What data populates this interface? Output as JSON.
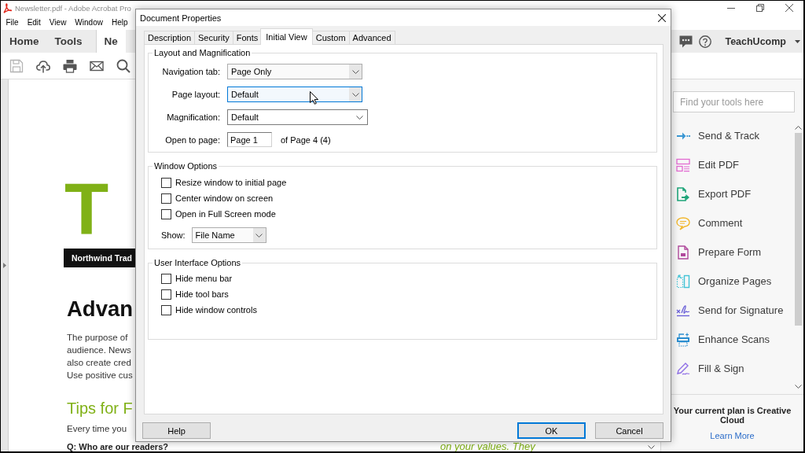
{
  "app_window": {
    "title": "Newsletter.pdf - Adobe Acrobat Pro",
    "menu": [
      "File",
      "Edit",
      "View",
      "Window",
      "Help"
    ],
    "nav_tabs": [
      {
        "label": "Home",
        "selected": false
      },
      {
        "label": "Tools",
        "selected": false
      },
      {
        "label": "Ne",
        "selected": true
      }
    ],
    "account": "TeachUcomp"
  },
  "document": {
    "title": "T",
    "banner": "Northwind Trad",
    "heading": "Advan",
    "paragraph_lines": [
      "The purpose of",
      "audience. News",
      "also create cred",
      "Use positive cus"
    ],
    "subheading": "Tips for F",
    "body": "Every time you",
    "question": "Q: Who are our readers?",
    "quote": "on your values. They"
  },
  "tools_panel": {
    "search": {
      "placeholder": "Find your tools here"
    },
    "tools": [
      {
        "label": "Send & Track",
        "color": "#3b97d3"
      },
      {
        "label": "Edit PDF",
        "color": "#e26ad1"
      },
      {
        "label": "Export PDF",
        "color": "#1fa57a"
      },
      {
        "label": "Comment",
        "color": "#f2b62a"
      },
      {
        "label": "Prepare Form",
        "color": "#b04a9c"
      },
      {
        "label": "Organize Pages",
        "color": "#42c3d6"
      },
      {
        "label": "Send for Signature",
        "color": "#6b61d8"
      },
      {
        "label": "Enhance Scans",
        "color": "#2b8ed0"
      },
      {
        "label": "Fill & Sign",
        "color": "#8f6fe6"
      }
    ],
    "plan_note": "Your current plan is Creative Cloud",
    "link": "Learn More"
  },
  "dialog": {
    "title": "Document Properties",
    "tabs": [
      {
        "label": "Description",
        "selected": false
      },
      {
        "label": "Security",
        "selected": false
      },
      {
        "label": "Fonts",
        "selected": false
      },
      {
        "label": "Initial View",
        "selected": true
      },
      {
        "label": "Custom",
        "selected": false
      },
      {
        "label": "Advanced",
        "selected": false
      }
    ],
    "groups": [
      {
        "title": "Layout and Magnification",
        "kind": "form",
        "rows": [
          {
            "kind": "dropdown",
            "label": "Navigation tab:",
            "value": "Page Only",
            "hovered": false
          },
          {
            "kind": "dropdown",
            "label": "Page layout:",
            "value": "Default",
            "hovered": true
          },
          {
            "kind": "combo",
            "label": "Magnification:",
            "value": "Default"
          },
          {
            "kind": "page",
            "label": "Open to page:",
            "value": "Page 1",
            "suffix": "of Page 4 (4)"
          }
        ]
      },
      {
        "title": "Window Options",
        "kind": "checklist",
        "rows": [
          {
            "kind": "checkbox",
            "label": "Resize window to initial page",
            "checked": false
          },
          {
            "kind": "checkbox",
            "label": "Center window on screen",
            "checked": false
          },
          {
            "kind": "checkbox",
            "label": "Open in Full Screen mode",
            "checked": false
          },
          {
            "kind": "dropdown",
            "label": "Show:",
            "value": "File Name",
            "hovered": false
          }
        ]
      },
      {
        "title": "User Interface Options",
        "kind": "checklist",
        "rows": [
          {
            "kind": "checkbox",
            "label": "Hide menu bar",
            "checked": false
          },
          {
            "kind": "checkbox",
            "label": "Hide tool bars",
            "checked": false
          },
          {
            "kind": "checkbox",
            "label": "Hide window controls",
            "checked": false
          }
        ]
      }
    ],
    "buttons": [
      {
        "label": "Help",
        "default": false
      },
      {
        "label": "OK",
        "default": true
      },
      {
        "label": "Cancel",
        "default": false
      }
    ]
  }
}
